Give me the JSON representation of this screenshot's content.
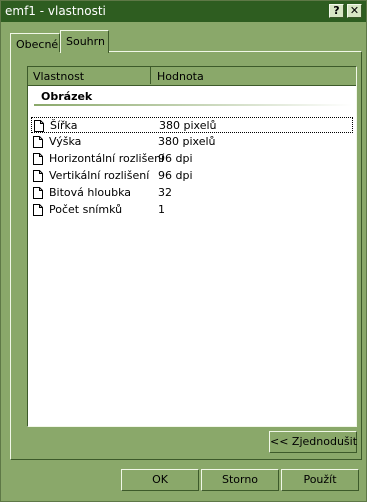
{
  "window": {
    "title": "emf1 - vlastnosti",
    "help_button": "?",
    "close_button": "✕"
  },
  "tabs": [
    {
      "label": "Obecné",
      "selected": false
    },
    {
      "label": "Souhrn",
      "selected": true
    }
  ],
  "list": {
    "columns": {
      "property": "Vlastnost",
      "value": "Hodnota"
    },
    "group": "Obrázek",
    "rows": [
      {
        "name": "Šířka",
        "value": "380 pixelů"
      },
      {
        "name": "Výška",
        "value": "380 pixelů"
      },
      {
        "name": "Horizontální rozlišení",
        "value": "96 dpi"
      },
      {
        "name": "Vertikální rozlišení",
        "value": "96 dpi"
      },
      {
        "name": "Bitová hloubka",
        "value": "32"
      },
      {
        "name": "Počet snímků",
        "value": "1"
      }
    ]
  },
  "buttons": {
    "simplify": "<< Zjednodušit",
    "ok": "OK",
    "cancel": "Storno",
    "apply": "Použít"
  },
  "colors": {
    "titlebar": "#2e5d20",
    "dialog_face": "#8aa86a",
    "list_background": "#ffffff"
  },
  "icons": {
    "row_icon": "document-icon"
  }
}
